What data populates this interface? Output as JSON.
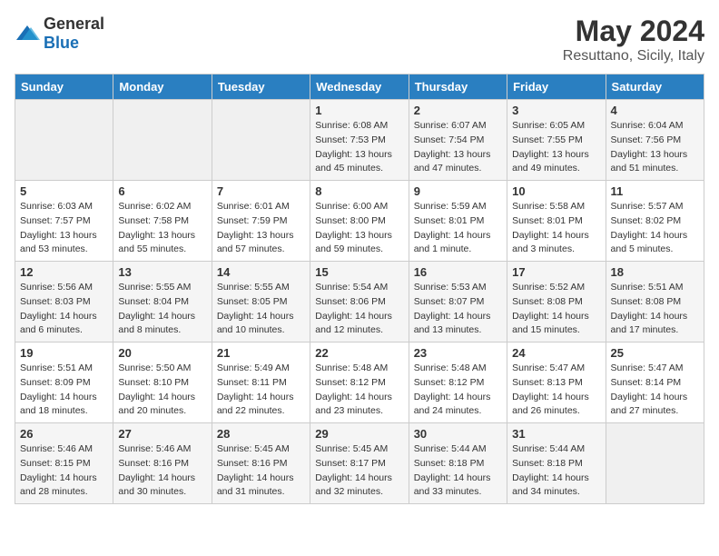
{
  "logo": {
    "general": "General",
    "blue": "Blue"
  },
  "title": "May 2024",
  "subtitle": "Resuttano, Sicily, Italy",
  "headers": [
    "Sunday",
    "Monday",
    "Tuesday",
    "Wednesday",
    "Thursday",
    "Friday",
    "Saturday"
  ],
  "weeks": [
    [
      {
        "date": "",
        "info": ""
      },
      {
        "date": "",
        "info": ""
      },
      {
        "date": "",
        "info": ""
      },
      {
        "date": "1",
        "info": "Sunrise: 6:08 AM\nSunset: 7:53 PM\nDaylight: 13 hours\nand 45 minutes."
      },
      {
        "date": "2",
        "info": "Sunrise: 6:07 AM\nSunset: 7:54 PM\nDaylight: 13 hours\nand 47 minutes."
      },
      {
        "date": "3",
        "info": "Sunrise: 6:05 AM\nSunset: 7:55 PM\nDaylight: 13 hours\nand 49 minutes."
      },
      {
        "date": "4",
        "info": "Sunrise: 6:04 AM\nSunset: 7:56 PM\nDaylight: 13 hours\nand 51 minutes."
      }
    ],
    [
      {
        "date": "5",
        "info": "Sunrise: 6:03 AM\nSunset: 7:57 PM\nDaylight: 13 hours\nand 53 minutes."
      },
      {
        "date": "6",
        "info": "Sunrise: 6:02 AM\nSunset: 7:58 PM\nDaylight: 13 hours\nand 55 minutes."
      },
      {
        "date": "7",
        "info": "Sunrise: 6:01 AM\nSunset: 7:59 PM\nDaylight: 13 hours\nand 57 minutes."
      },
      {
        "date": "8",
        "info": "Sunrise: 6:00 AM\nSunset: 8:00 PM\nDaylight: 13 hours\nand 59 minutes."
      },
      {
        "date": "9",
        "info": "Sunrise: 5:59 AM\nSunset: 8:01 PM\nDaylight: 14 hours\nand 1 minute."
      },
      {
        "date": "10",
        "info": "Sunrise: 5:58 AM\nSunset: 8:01 PM\nDaylight: 14 hours\nand 3 minutes."
      },
      {
        "date": "11",
        "info": "Sunrise: 5:57 AM\nSunset: 8:02 PM\nDaylight: 14 hours\nand 5 minutes."
      }
    ],
    [
      {
        "date": "12",
        "info": "Sunrise: 5:56 AM\nSunset: 8:03 PM\nDaylight: 14 hours\nand 6 minutes."
      },
      {
        "date": "13",
        "info": "Sunrise: 5:55 AM\nSunset: 8:04 PM\nDaylight: 14 hours\nand 8 minutes."
      },
      {
        "date": "14",
        "info": "Sunrise: 5:55 AM\nSunset: 8:05 PM\nDaylight: 14 hours\nand 10 minutes."
      },
      {
        "date": "15",
        "info": "Sunrise: 5:54 AM\nSunset: 8:06 PM\nDaylight: 14 hours\nand 12 minutes."
      },
      {
        "date": "16",
        "info": "Sunrise: 5:53 AM\nSunset: 8:07 PM\nDaylight: 14 hours\nand 13 minutes."
      },
      {
        "date": "17",
        "info": "Sunrise: 5:52 AM\nSunset: 8:08 PM\nDaylight: 14 hours\nand 15 minutes."
      },
      {
        "date": "18",
        "info": "Sunrise: 5:51 AM\nSunset: 8:08 PM\nDaylight: 14 hours\nand 17 minutes."
      }
    ],
    [
      {
        "date": "19",
        "info": "Sunrise: 5:51 AM\nSunset: 8:09 PM\nDaylight: 14 hours\nand 18 minutes."
      },
      {
        "date": "20",
        "info": "Sunrise: 5:50 AM\nSunset: 8:10 PM\nDaylight: 14 hours\nand 20 minutes."
      },
      {
        "date": "21",
        "info": "Sunrise: 5:49 AM\nSunset: 8:11 PM\nDaylight: 14 hours\nand 22 minutes."
      },
      {
        "date": "22",
        "info": "Sunrise: 5:48 AM\nSunset: 8:12 PM\nDaylight: 14 hours\nand 23 minutes."
      },
      {
        "date": "23",
        "info": "Sunrise: 5:48 AM\nSunset: 8:12 PM\nDaylight: 14 hours\nand 24 minutes."
      },
      {
        "date": "24",
        "info": "Sunrise: 5:47 AM\nSunset: 8:13 PM\nDaylight: 14 hours\nand 26 minutes."
      },
      {
        "date": "25",
        "info": "Sunrise: 5:47 AM\nSunset: 8:14 PM\nDaylight: 14 hours\nand 27 minutes."
      }
    ],
    [
      {
        "date": "26",
        "info": "Sunrise: 5:46 AM\nSunset: 8:15 PM\nDaylight: 14 hours\nand 28 minutes."
      },
      {
        "date": "27",
        "info": "Sunrise: 5:46 AM\nSunset: 8:16 PM\nDaylight: 14 hours\nand 30 minutes."
      },
      {
        "date": "28",
        "info": "Sunrise: 5:45 AM\nSunset: 8:16 PM\nDaylight: 14 hours\nand 31 minutes."
      },
      {
        "date": "29",
        "info": "Sunrise: 5:45 AM\nSunset: 8:17 PM\nDaylight: 14 hours\nand 32 minutes."
      },
      {
        "date": "30",
        "info": "Sunrise: 5:44 AM\nSunset: 8:18 PM\nDaylight: 14 hours\nand 33 minutes."
      },
      {
        "date": "31",
        "info": "Sunrise: 5:44 AM\nSunset: 8:18 PM\nDaylight: 14 hours\nand 34 minutes."
      },
      {
        "date": "",
        "info": ""
      }
    ]
  ]
}
